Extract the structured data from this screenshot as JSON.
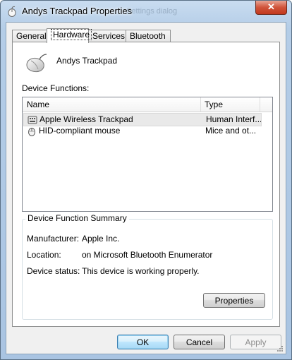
{
  "window": {
    "title": "Andys Trackpad Properties",
    "title_ghost": "Settings dialog",
    "close_label": "✕"
  },
  "tabs": [
    {
      "label": "General"
    },
    {
      "label": "Hardware"
    },
    {
      "label": "Services"
    },
    {
      "label": "Bluetooth"
    }
  ],
  "device": {
    "name": "Andys Trackpad",
    "icon": "mouse-icon"
  },
  "device_functions": {
    "label": "Device Functions:",
    "columns": [
      "Name",
      "Type"
    ],
    "rows": [
      {
        "name": "Apple Wireless Trackpad",
        "type": "Human Interf...",
        "icon": "keyboard-icon",
        "selected": true
      },
      {
        "name": "HID-compliant mouse",
        "type": "Mice and ot...",
        "icon": "mouse-icon",
        "selected": false
      }
    ]
  },
  "summary": {
    "title": "Device Function Summary",
    "manufacturer_label": "Manufacturer:",
    "manufacturer_value": "Apple Inc.",
    "location_label": "Location:",
    "location_value": "on Microsoft Bluetooth Enumerator",
    "status_label": "Device status:",
    "status_value": "This device is working properly.",
    "properties_button": "Properties"
  },
  "footer": {
    "ok": "OK",
    "cancel": "Cancel",
    "apply": "Apply"
  },
  "colors": {
    "titlebar": "#b4cde7",
    "close_button": "#c7452a",
    "selection": "#e9e9e9"
  }
}
